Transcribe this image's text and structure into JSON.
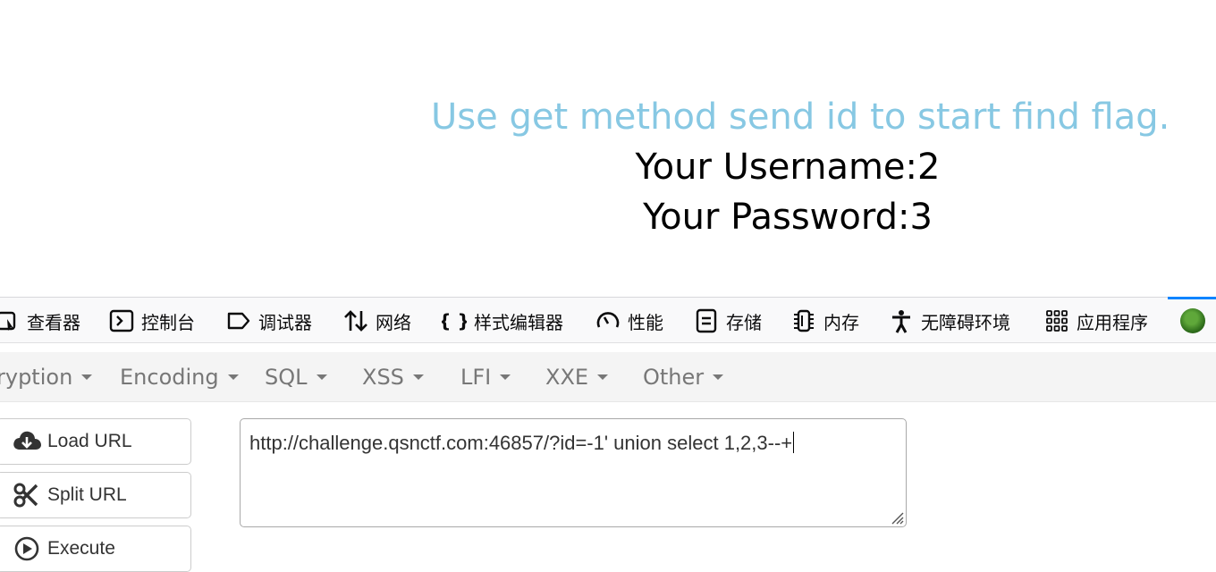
{
  "page": {
    "headline": "Use get method send id to start find flag.",
    "username": "Your Username:2",
    "password": "Your Password:3"
  },
  "devtools": {
    "tabs": [
      {
        "label": "查看器",
        "icon": "inspector-icon"
      },
      {
        "label": "控制台",
        "icon": "console-icon"
      },
      {
        "label": "调试器",
        "icon": "debugger-icon"
      },
      {
        "label": "网络",
        "icon": "network-icon"
      },
      {
        "label": "样式编辑器",
        "icon": "style-editor-icon"
      },
      {
        "label": "性能",
        "icon": "performance-icon"
      },
      {
        "label": "存储",
        "icon": "storage-icon"
      },
      {
        "label": "内存",
        "icon": "memory-icon"
      },
      {
        "label": "无障碍环境",
        "icon": "accessibility-icon"
      },
      {
        "label": "应用程序",
        "icon": "application-icon"
      }
    ],
    "accent_color": "#0a84ff"
  },
  "hackbar": {
    "menu": [
      {
        "label": "ryption"
      },
      {
        "label": "Encoding"
      },
      {
        "label": "SQL"
      },
      {
        "label": "XSS"
      },
      {
        "label": "LFI"
      },
      {
        "label": "XXE"
      },
      {
        "label": "Other"
      }
    ],
    "buttons": {
      "load": "Load URL",
      "split": "Split URL",
      "execute": "Execute"
    },
    "url_value": "http://challenge.qsnctf.com:46857/?id=-1' union select 1,2,3--+"
  },
  "colors": {
    "headline": "#87c8e3",
    "menu_text": "#777777"
  }
}
